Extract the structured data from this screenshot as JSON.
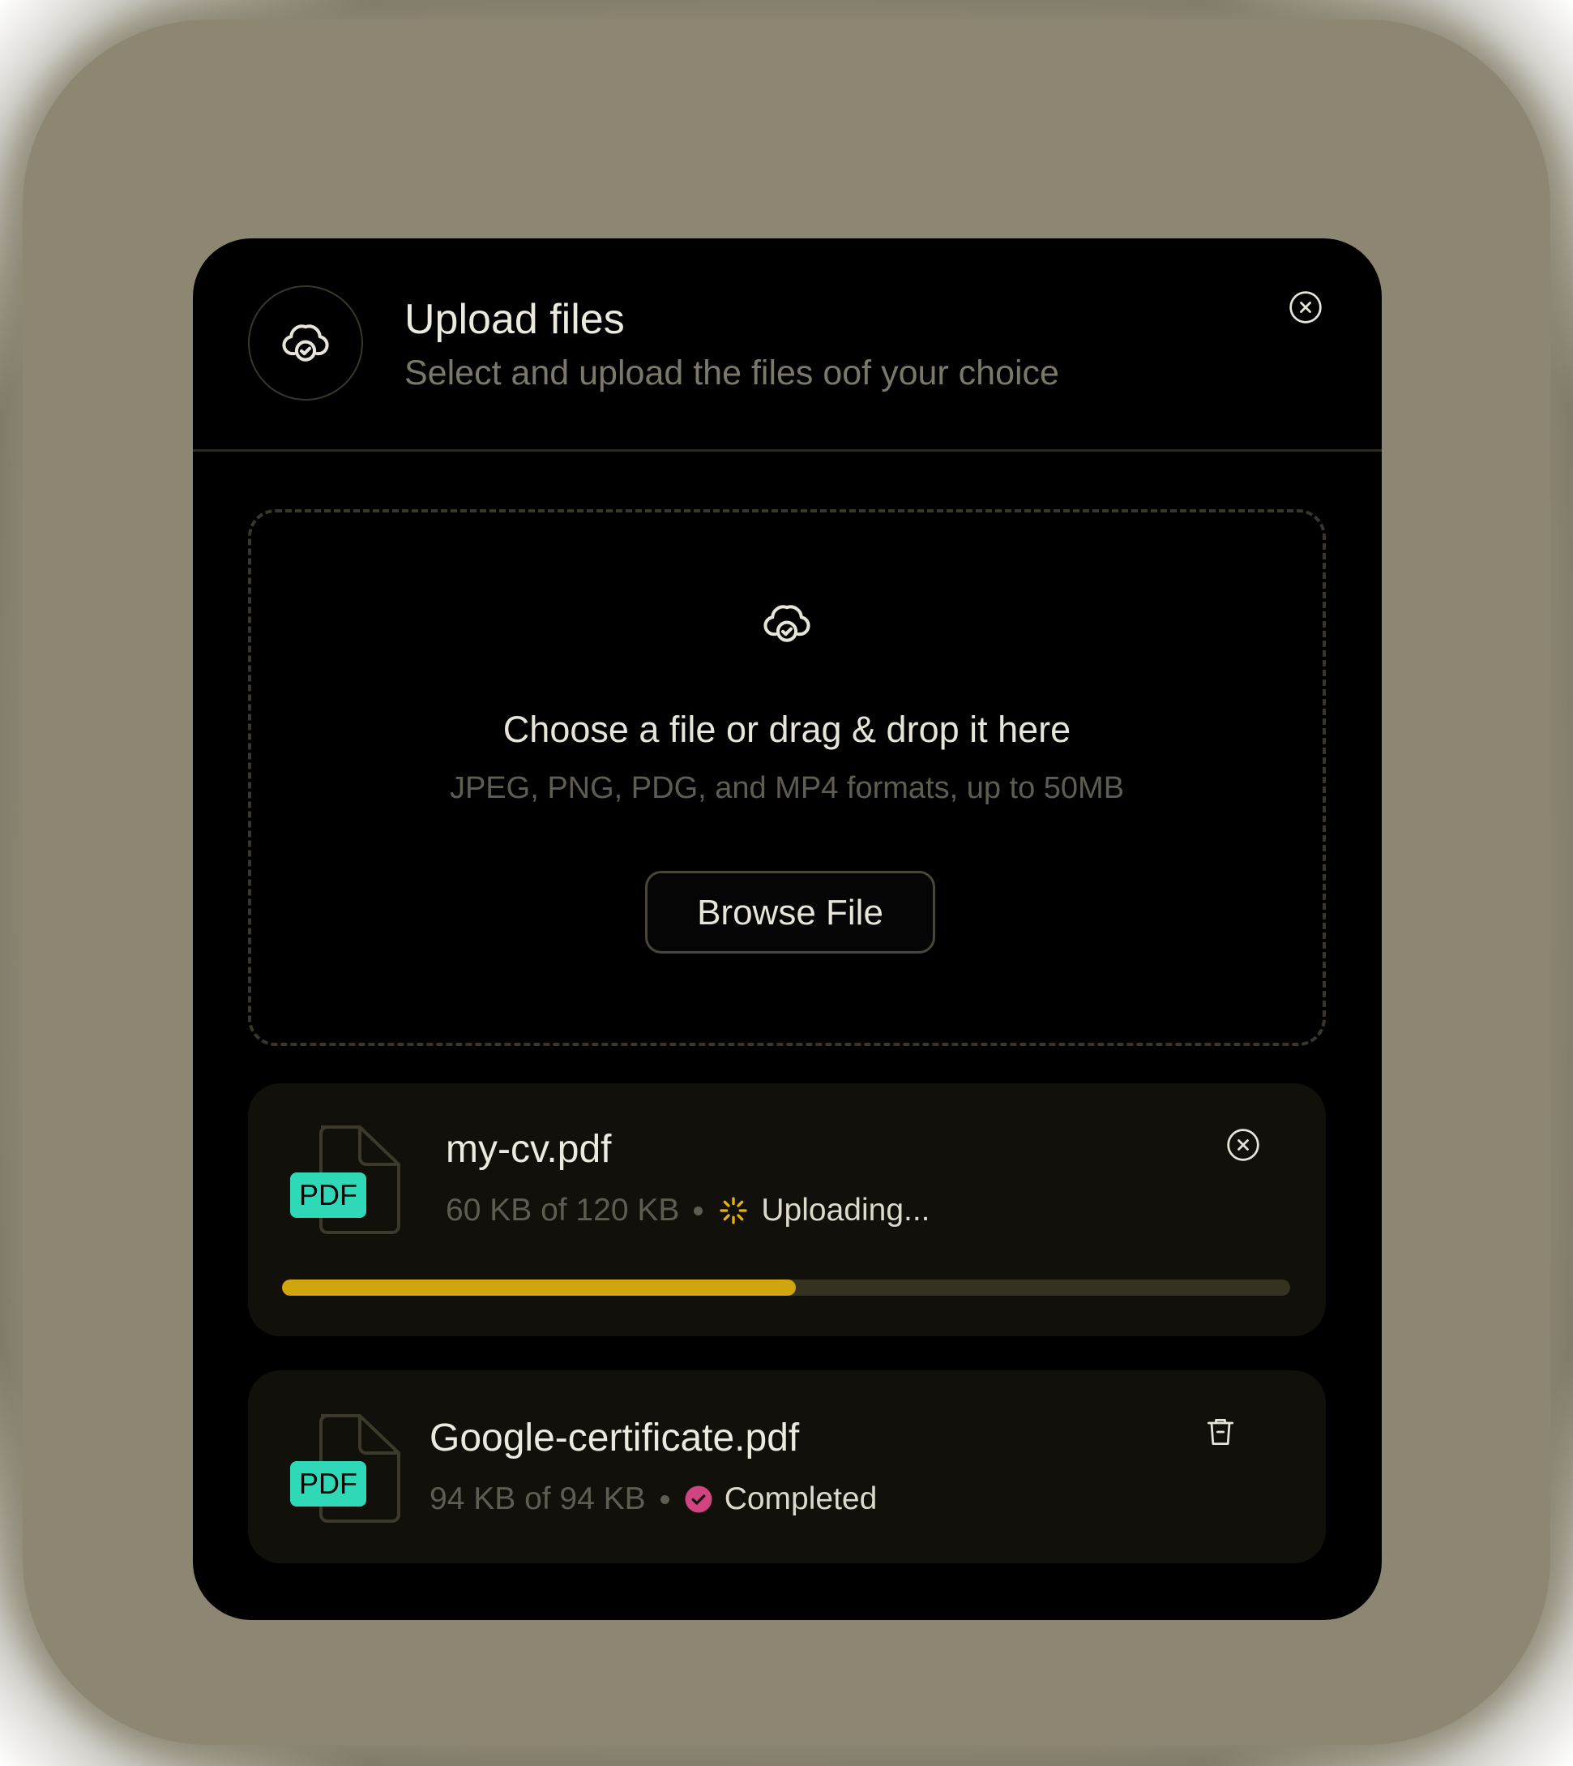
{
  "modal": {
    "title": "Upload files",
    "subtitle": "Select and upload the files oof your choice",
    "header_icon": "cloud-check-icon",
    "close_icon": "close-circle-icon"
  },
  "dropzone": {
    "icon": "cloud-check-icon",
    "title": "Choose a file or drag & drop it here",
    "subtitle": "JPEG, PNG, PDG, and MP4 formats, up to 50MB",
    "browse_label": "Browse File"
  },
  "files": [
    {
      "name": "my-cv.pdf",
      "badge": "PDF",
      "size": "60 KB of 120 KB",
      "status": "Uploading...",
      "status_icon": "spinner-icon",
      "progress": 0.51,
      "action_icon": "close-circle-icon"
    },
    {
      "name": "Google-certificate.pdf",
      "badge": "PDF",
      "size": "94 KB of 94 KB",
      "status": "Completed",
      "status_icon": "check-circle-icon",
      "action_icon": "trash-icon"
    }
  ],
  "colors": {
    "accent_progress": "#d1a50d",
    "pdf_badge": "#2fd9b8",
    "completed": "#d0457f",
    "spinner": "#e6b30c"
  }
}
